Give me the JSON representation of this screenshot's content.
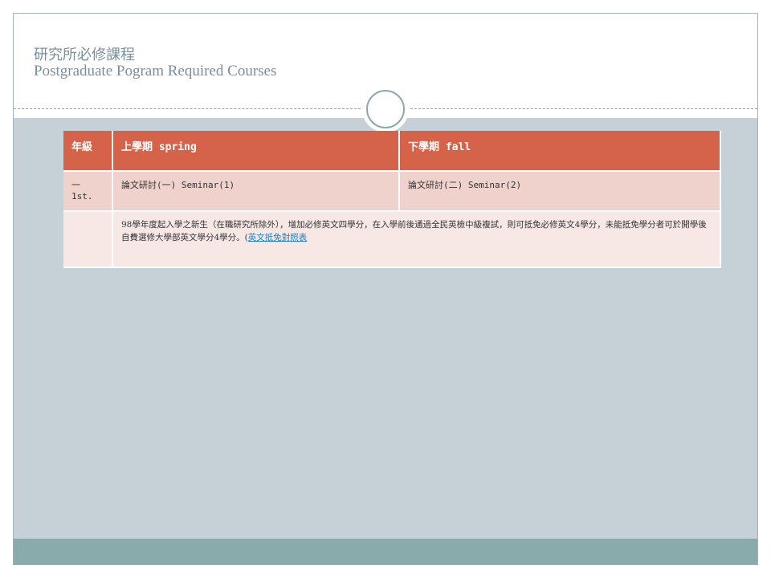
{
  "header": {
    "title_zh": "研究所必修課程",
    "title_en": "Postgraduate Pogram Required Courses"
  },
  "table": {
    "headers": [
      "年級",
      "上學期 spring",
      "下學期 fall"
    ],
    "rows": [
      {
        "grade": "一 1st.",
        "spring": "論文研討(一)  Seminar(1)",
        "fall": "論文研討(二)  Seminar(2)"
      }
    ],
    "note": {
      "text": "98學年度起入學之新生（在職研究所除外），增加必修英文四學分，在入學前後通過全民英檢中級複試，則可抵免必修英文4學分，未能抵免學分者可於開學後自費選修大學部英文學分4學分。(",
      "link_text": "英文抵免對照表"
    }
  },
  "colors": {
    "header_row": "#d4634a",
    "row_light": "#f0d2cd",
    "row_lighter": "#f7e8e6",
    "body_bg": "#c6d1d7",
    "footer_band": "#89abab",
    "title_text": "#7a8f9b",
    "link": "#1b7fbf"
  }
}
